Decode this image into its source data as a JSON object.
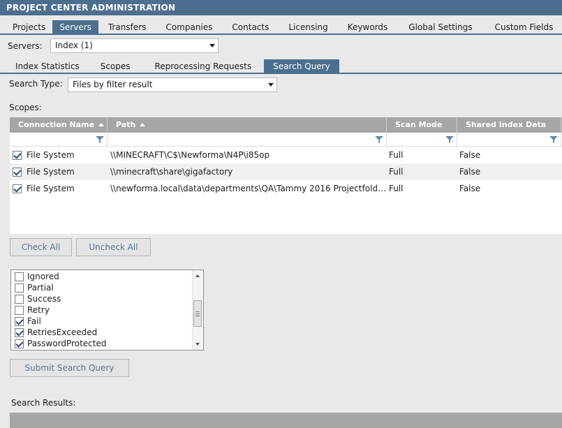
{
  "title": "PROJECT CENTER ADMINISTRATION",
  "main_tabs": [
    {
      "label": "Projects",
      "active": false
    },
    {
      "label": "Servers",
      "active": true
    },
    {
      "label": "Transfers",
      "active": false
    },
    {
      "label": "Companies",
      "active": false
    },
    {
      "label": "Contacts",
      "active": false
    },
    {
      "label": "Licensing",
      "active": false
    },
    {
      "label": "Keywords",
      "active": false
    },
    {
      "label": "Global Settings",
      "active": false
    },
    {
      "label": "Custom Fields",
      "active": false
    }
  ],
  "servers": {
    "label": "Servers:",
    "value": "Index (1)"
  },
  "sub_tabs": [
    {
      "label": "Index Statistics",
      "active": false
    },
    {
      "label": "Scopes",
      "active": false
    },
    {
      "label": "Reprocessing Requests",
      "active": false
    },
    {
      "label": "Search Query",
      "active": true
    }
  ],
  "search_type": {
    "label": "Search Type:",
    "value": "Files by filter result"
  },
  "scopes_label": "Scopes:",
  "grid": {
    "columns": [
      "Connection Name",
      "Path",
      "Scan Mode",
      "Shared Index Data"
    ],
    "rows": [
      {
        "checked": true,
        "connection": "File System",
        "path": "\\\\MINECRAFT\\C$\\Newforma\\N4P\\i85op",
        "scan_mode": "Full",
        "shared": "False"
      },
      {
        "checked": true,
        "connection": "File System",
        "path": "\\\\minecraft\\share\\gigafactory",
        "scan_mode": "Full",
        "shared": "False"
      },
      {
        "checked": true,
        "connection": "File System",
        "path": "\\\\newforma.local\\data\\departments\\QA\\Tammy 2016 Projectfolders...",
        "scan_mode": "Full",
        "shared": "False"
      }
    ]
  },
  "check_all": "Check All",
  "uncheck_all": "Uncheck All",
  "status_filters": [
    {
      "label": "Ignored",
      "checked": false
    },
    {
      "label": "Partial",
      "checked": false
    },
    {
      "label": "Success",
      "checked": false
    },
    {
      "label": "Retry",
      "checked": false
    },
    {
      "label": "Fail",
      "checked": true
    },
    {
      "label": "RetriesExceeded",
      "checked": true
    },
    {
      "label": "PasswordProtected",
      "checked": true
    }
  ],
  "submit": "Submit Search Query",
  "results_label": "Search Results:"
}
